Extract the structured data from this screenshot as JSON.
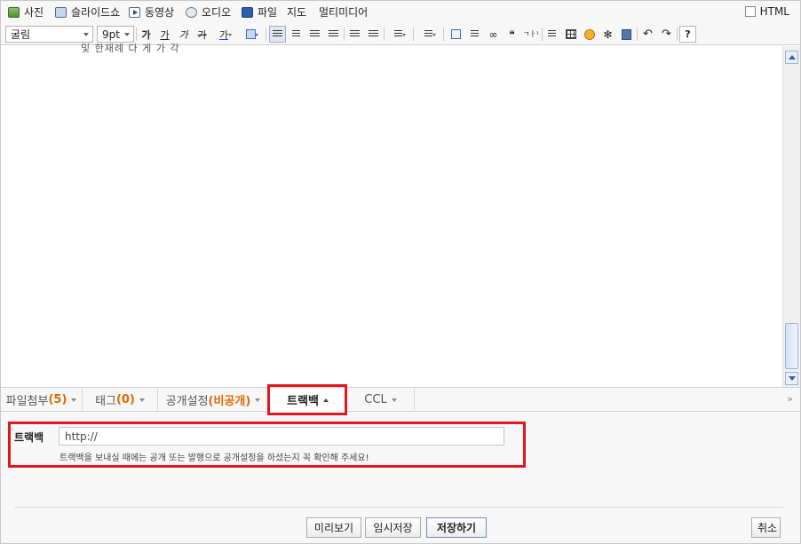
{
  "media_bar": {
    "items": [
      {
        "label": "사진",
        "icon": "photo-icon"
      },
      {
        "label": "슬라이드쇼",
        "icon": "slideshow-icon"
      },
      {
        "label": "동영상",
        "icon": "video-icon"
      },
      {
        "label": "오디오",
        "icon": "audio-icon"
      },
      {
        "label": "파일",
        "icon": "file-icon"
      },
      {
        "label": "지도",
        "icon": ""
      },
      {
        "label": "멀티미디어",
        "icon": ""
      }
    ],
    "html_label": "HTML"
  },
  "format_bar": {
    "font_family": "굴림",
    "font_size": "9pt",
    "bold": "가",
    "underline": "가",
    "italic": "가",
    "strike": "가",
    "font_color": "가",
    "quote": "❝",
    "char_map": "ㄱㅏ¹",
    "undo": "↶",
    "redo": "↷",
    "help": "?"
  },
  "editor": {
    "cut_text": "및 한재례 다 게 가 각"
  },
  "tabs": [
    {
      "label": "파일첨부",
      "count": "(5)"
    },
    {
      "label": "태그",
      "count": "(0)"
    },
    {
      "label": "공개설정",
      "count": "(비공개)"
    },
    {
      "label": "트랙백",
      "count": ""
    },
    {
      "label": "CCL",
      "count": ""
    }
  ],
  "collapse_icon": "»",
  "trackback": {
    "label": "트랙백",
    "value": "http://",
    "note": "트랙백을 보내실 때에는 공개 또는 발행으로 공개설정을 하셨는지 꼭 확인해 주세요!"
  },
  "footer": {
    "preview": "미리보기",
    "temp_save": "임시저장",
    "save": "저장하기",
    "cancel": "취소"
  },
  "colors": {
    "highlight": "#e3161f",
    "count_accent": "#e06a00"
  }
}
